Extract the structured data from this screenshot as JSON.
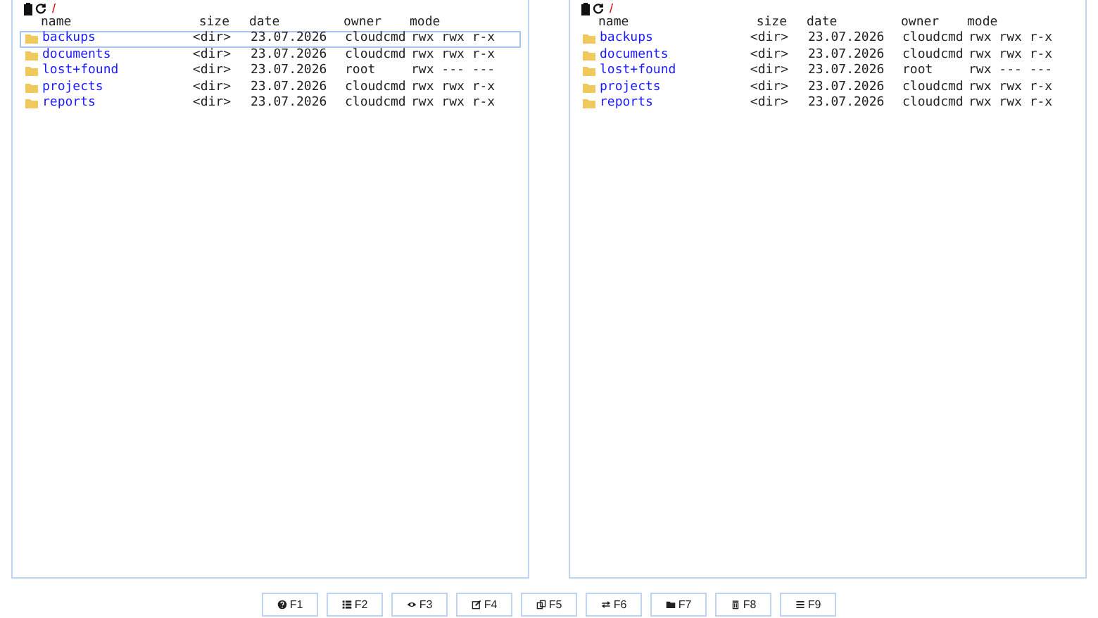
{
  "panels": [
    {
      "path": "/",
      "columns": [
        "name",
        "size",
        "date",
        "owner",
        "mode"
      ],
      "rows": [
        {
          "name": "backups",
          "size": "<dir>",
          "date": "23.07.2026",
          "owner": "cloudcmd",
          "mode": "rwx rwx r-x",
          "selected": true
        },
        {
          "name": "documents",
          "size": "<dir>",
          "date": "23.07.2026",
          "owner": "cloudcmd",
          "mode": "rwx rwx r-x",
          "selected": false
        },
        {
          "name": "lost+found",
          "size": "<dir>",
          "date": "23.07.2026",
          "owner": "root",
          "mode": "rwx --- ---",
          "selected": false
        },
        {
          "name": "projects",
          "size": "<dir>",
          "date": "23.07.2026",
          "owner": "cloudcmd",
          "mode": "rwx rwx r-x",
          "selected": false
        },
        {
          "name": "reports",
          "size": "<dir>",
          "date": "23.07.2026",
          "owner": "cloudcmd",
          "mode": "rwx rwx r-x",
          "selected": false
        }
      ]
    },
    {
      "path": "/",
      "columns": [
        "name",
        "size",
        "date",
        "owner",
        "mode"
      ],
      "rows": [
        {
          "name": "backups",
          "size": "<dir>",
          "date": "23.07.2026",
          "owner": "cloudcmd",
          "mode": "rwx rwx r-x",
          "selected": false
        },
        {
          "name": "documents",
          "size": "<dir>",
          "date": "23.07.2026",
          "owner": "cloudcmd",
          "mode": "rwx rwx r-x",
          "selected": false
        },
        {
          "name": "lost+found",
          "size": "<dir>",
          "date": "23.07.2026",
          "owner": "root",
          "mode": "rwx --- ---",
          "selected": false
        },
        {
          "name": "projects",
          "size": "<dir>",
          "date": "23.07.2026",
          "owner": "cloudcmd",
          "mode": "rwx rwx r-x",
          "selected": false
        },
        {
          "name": "reports",
          "size": "<dir>",
          "date": "23.07.2026",
          "owner": "cloudcmd",
          "mode": "rwx rwx r-x",
          "selected": false
        }
      ]
    }
  ],
  "function_keys": [
    {
      "label": "F1",
      "kind": "help"
    },
    {
      "label": "F2",
      "kind": "list"
    },
    {
      "label": "F3",
      "kind": "view"
    },
    {
      "label": "F4",
      "kind": "edit"
    },
    {
      "label": "F5",
      "kind": "copy"
    },
    {
      "label": "F6",
      "kind": "move"
    },
    {
      "label": "F7",
      "kind": "folder"
    },
    {
      "label": "F8",
      "kind": "delete"
    },
    {
      "label": "F9",
      "kind": "menu"
    }
  ]
}
